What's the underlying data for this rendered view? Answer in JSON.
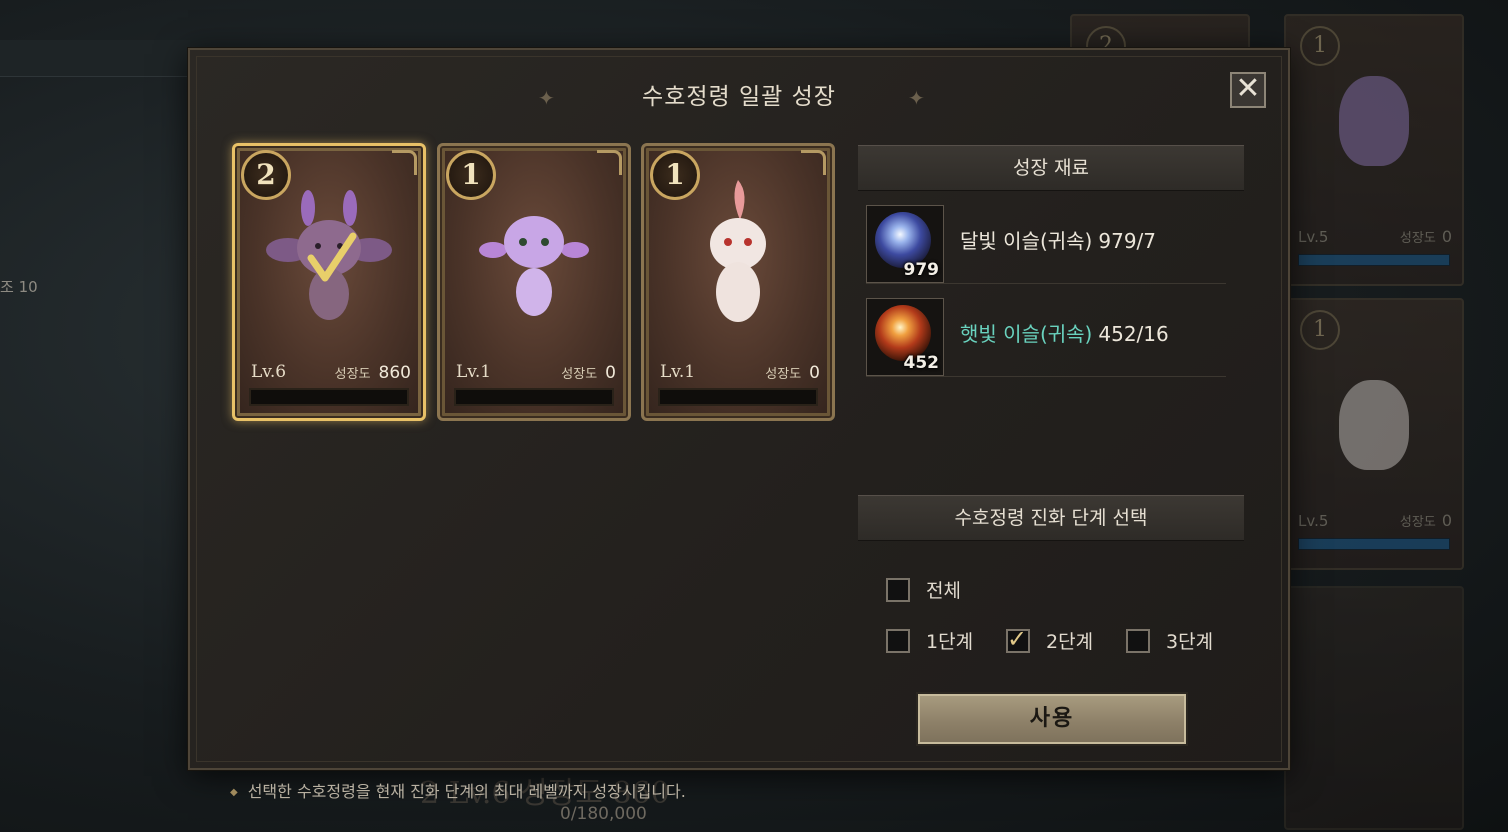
{
  "background": {
    "side_text": "조 10",
    "cards": [
      {
        "num": "2",
        "level": "",
        "growth_label": "",
        "growth_value": ""
      },
      {
        "num": "1",
        "level": "Lv.5",
        "growth_label": "성장도",
        "growth_value": "0"
      },
      {
        "num": "1",
        "level": "Lv.5",
        "growth_label": "성장도",
        "growth_value": "0"
      }
    ],
    "bottom_progress": "0/180,000",
    "ghost_text": "2   Lv.6   성장도 860"
  },
  "modal": {
    "title": "수호정령 일괄 성장",
    "close_icon": "✕",
    "cards": [
      {
        "num": "2",
        "level": "Lv.6",
        "growth_label": "성장도",
        "growth_value": "860",
        "selected": true,
        "creature": "purple-bunny-spirit-icon"
      },
      {
        "num": "1",
        "level": "Lv.1",
        "growth_label": "성장도",
        "growth_value": "0",
        "selected": false,
        "creature": "lavender-spirit-icon"
      },
      {
        "num": "1",
        "level": "Lv.1",
        "growth_label": "성장도",
        "growth_value": "0",
        "selected": false,
        "creature": "white-feather-spirit-icon"
      }
    ],
    "materials_header": "성장 재료",
    "materials": [
      {
        "name": "달빛 이슬(귀속)",
        "count": "979/7",
        "qty": "979",
        "color": "#ece6da",
        "icon": "moonlight-dew-icon"
      },
      {
        "name": "햇빛 이슬(귀속)",
        "count": "452/16",
        "qty": "452",
        "color": "#69d2be",
        "icon": "sunlight-dew-icon"
      }
    ],
    "evolution_header": "수호정령 진화 단계 선택",
    "options": {
      "all": {
        "label": "전체",
        "checked": false
      },
      "stage1": {
        "label": "1단계",
        "checked": false
      },
      "stage2": {
        "label": "2단계",
        "checked": true
      },
      "stage3": {
        "label": "3단계",
        "checked": false
      }
    },
    "use_button": "사용"
  },
  "tip": "선택한 수호정령을 현재 진화 단계의 최대 레벨까지 성장시킵니다."
}
